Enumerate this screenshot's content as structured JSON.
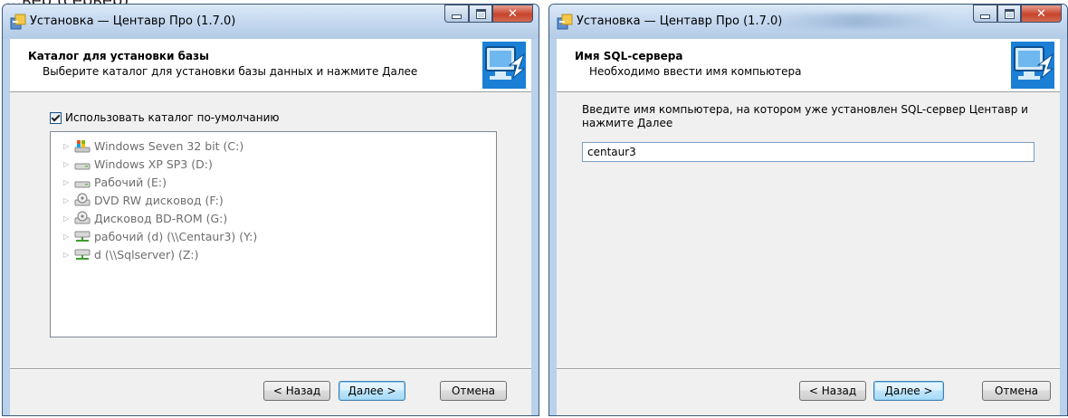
{
  "caption_fragment": "…вер (сервер)",
  "left_window": {
    "title": "Установка — Центавр Про (1.7.0)",
    "header": {
      "title": "Каталог для установки базы",
      "subtitle": "Выберите каталог для установки базы данных и нажмите Далее"
    },
    "use_default_checkbox": {
      "label": "Использовать каталог по-умолчанию",
      "checked": true
    },
    "drives": [
      {
        "label": "Windows Seven 32 bit (C:)",
        "icon": "system-drive-icon"
      },
      {
        "label": "Windows XP SP3 (D:)",
        "icon": "hard-drive-icon"
      },
      {
        "label": "Рабочий (E:)",
        "icon": "hard-drive-icon"
      },
      {
        "label": "DVD RW дисковод (F:)",
        "icon": "optical-drive-icon"
      },
      {
        "label": "Дисковод BD-ROM (G:)",
        "icon": "optical-drive-icon"
      },
      {
        "label": "рабочий (d) (\\\\Centaur3) (Y:)",
        "icon": "network-drive-icon"
      },
      {
        "label": "d (\\\\Sqlserver) (Z:)",
        "icon": "network-drive-icon"
      }
    ],
    "buttons": {
      "back": "< Назад",
      "next": "Далее >",
      "cancel": "Отмена"
    }
  },
  "right_window": {
    "title": "Установка — Центавр Про (1.7.0)",
    "header": {
      "title": "Имя SQL-сервера",
      "subtitle": "Необходимо ввести имя компьютера"
    },
    "prompt": "Введите имя компьютера, на котором уже установлен SQL-сервер Центавр и нажмите Далее",
    "server_name_value": "centaur3",
    "buttons": {
      "back": "< Назад",
      "next": "Далее >",
      "cancel": "Отмена"
    }
  },
  "colors": {
    "title_bar": "#c4d8ef",
    "close_button": "#c7432b",
    "default_button_border": "#3c7fb1"
  }
}
